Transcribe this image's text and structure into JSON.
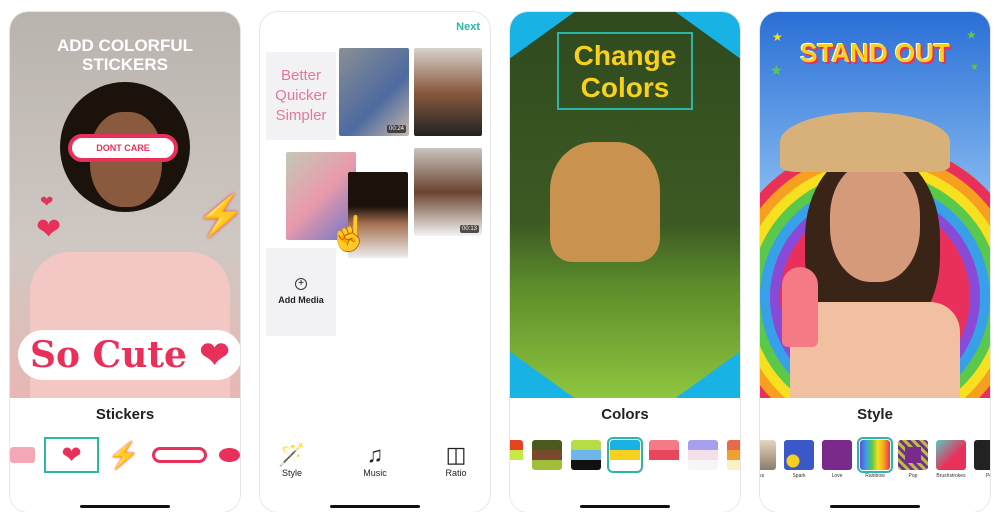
{
  "panels": [
    {
      "headline": "ADD COLORFUL STICKERS",
      "sticker_text": "So Cute",
      "glasses_text": "DONT CARE",
      "label": "Stickers",
      "accent": "#e8305b"
    },
    {
      "next": "Next",
      "tagline": [
        "Better",
        "Quicker",
        "Simpler"
      ],
      "durations": [
        "00:24",
        "00:13"
      ],
      "add_media": "Add Media",
      "tools": [
        {
          "label": "Style",
          "icon": "magic-wand-icon"
        },
        {
          "label": "Music",
          "icon": "music-note-icon"
        },
        {
          "label": "Ratio",
          "icon": "ratio-icon"
        }
      ],
      "accent": "#2bb6a6"
    },
    {
      "headline": "Change Colors",
      "label": "Colors",
      "swatches": [
        [
          "#e5431f",
          "#c7e845",
          "#fff"
        ],
        [
          "#4a5a1f",
          "#7a4a2e",
          "#9fbf3b"
        ],
        [
          "#b6dd48",
          "#6cb6e8",
          "#111"
        ],
        [
          "#18b2e5",
          "#f7d020",
          "#fff"
        ],
        [
          "#f47a86",
          "#e8465a",
          "#fff"
        ],
        [
          "#a7a0f0",
          "#f4e0ea",
          "#f6f6f6"
        ],
        [
          "#e56a4a",
          "#f0a030",
          "#faf0c0"
        ]
      ],
      "selected_swatch": 3
    },
    {
      "headline": "STAND OUT",
      "label": "Style",
      "styles": [
        "ies",
        "Spark",
        "Love",
        "Rainbow",
        "Pop",
        "Brushstrokes",
        "Po"
      ],
      "selected_style": 3
    }
  ]
}
